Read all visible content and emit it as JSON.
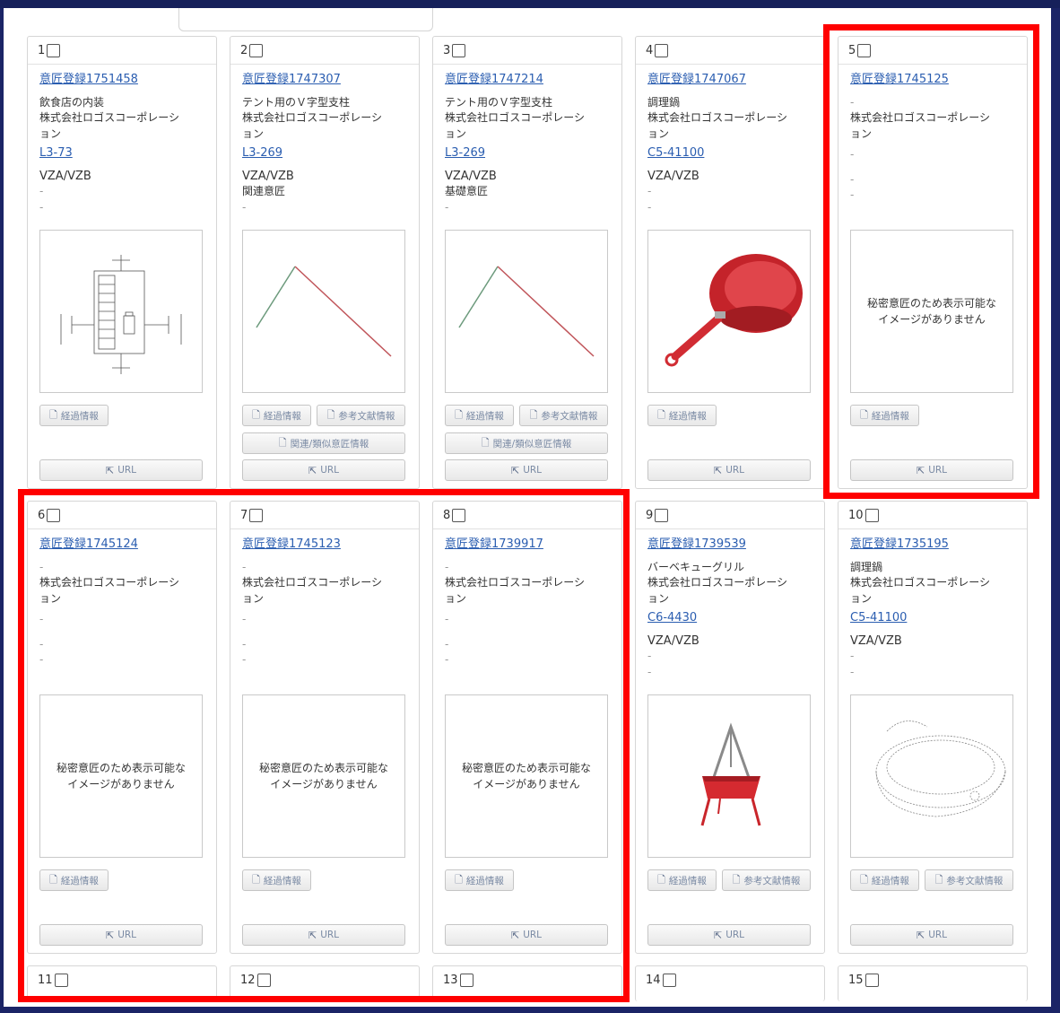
{
  "labels": {
    "keika": "経過情報",
    "sanko": "参考文献情報",
    "kanren": "関連/類似意匠情報",
    "url": "URL",
    "secret_line1": "秘密意匠のため表示可能な",
    "secret_line2": "イメージがありません"
  },
  "cards": [
    {
      "n": "1",
      "reg": "意匠登録1751458",
      "l1": "飲食店の内装",
      "l2": "株式会社ロゴスコーポレーシ",
      "l3": "ョン",
      "num": "L3-73",
      "code": "VZA/VZB",
      "f1": "-",
      "f2": "-",
      "image": "floorplan-drawing"
    },
    {
      "n": "2",
      "reg": "意匠登録1747307",
      "l1": "テント用のＶ字型支柱",
      "l2": "株式会社ロゴスコーポレーシ",
      "l3": "ョン",
      "num": "L3-269",
      "code": "VZA/VZB",
      "f1": "関連意匠",
      "f2": "-",
      "image": "v-pole-drawing"
    },
    {
      "n": "3",
      "reg": "意匠登録1747214",
      "l1": "テント用のＶ字型支柱",
      "l2": "株式会社ロゴスコーポレーシ",
      "l3": "ョン",
      "num": "L3-269",
      "code": "VZA/VZB",
      "f1": "基礎意匠",
      "f2": "-",
      "image": "v-pole-drawing"
    },
    {
      "n": "4",
      "reg": "意匠登録1747067",
      "l1": "調理鍋",
      "l2": "株式会社ロゴスコーポレーシ",
      "l3": "ョン",
      "num": "C5-41100",
      "code": "VZA/VZB",
      "f1": "-",
      "f2": "-",
      "image": "red-pan-photo"
    },
    {
      "n": "5",
      "reg": "意匠登録1745125",
      "l1": "-",
      "l2": "株式会社ロゴスコーポレーシ",
      "l3": "ョン",
      "num": "",
      "code": "-",
      "f1": "-",
      "f2": "-",
      "image": "secret"
    },
    {
      "n": "6",
      "reg": "意匠登録1745124",
      "l1": "-",
      "l2": "株式会社ロゴスコーポレーシ",
      "l3": "ョン",
      "num": "",
      "code": "-",
      "f1": "-",
      "f2": "-",
      "image": "secret"
    },
    {
      "n": "7",
      "reg": "意匠登録1745123",
      "l1": "-",
      "l2": "株式会社ロゴスコーポレーシ",
      "l3": "ョン",
      "num": "",
      "code": "-",
      "f1": "-",
      "f2": "-",
      "image": "secret"
    },
    {
      "n": "8",
      "reg": "意匠登録1739917",
      "l1": "-",
      "l2": "株式会社ロゴスコーポレーシ",
      "l3": "ョン",
      "num": "",
      "code": "-",
      "f1": "-",
      "f2": "-",
      "image": "secret"
    },
    {
      "n": "9",
      "reg": "意匠登録1739539",
      "l1": "バーベキューグリル",
      "l2": "株式会社ロゴスコーポレーシ",
      "l3": "ョン",
      "num": "C6-4430",
      "code": "VZA/VZB",
      "f1": "-",
      "f2": "-",
      "image": "bbq-grill-photo"
    },
    {
      "n": "10",
      "reg": "意匠登録1735195",
      "l1": "調理鍋",
      "l2": "株式会社ロゴスコーポレーシ",
      "l3": "ョン",
      "num": "C5-41100",
      "code": "VZA/VZB",
      "f1": "-",
      "f2": "-",
      "image": "pan-line-drawing"
    }
  ],
  "partial_cards": [
    "11",
    "12",
    "13",
    "14",
    "15"
  ],
  "highlight_color": "#ff0000"
}
